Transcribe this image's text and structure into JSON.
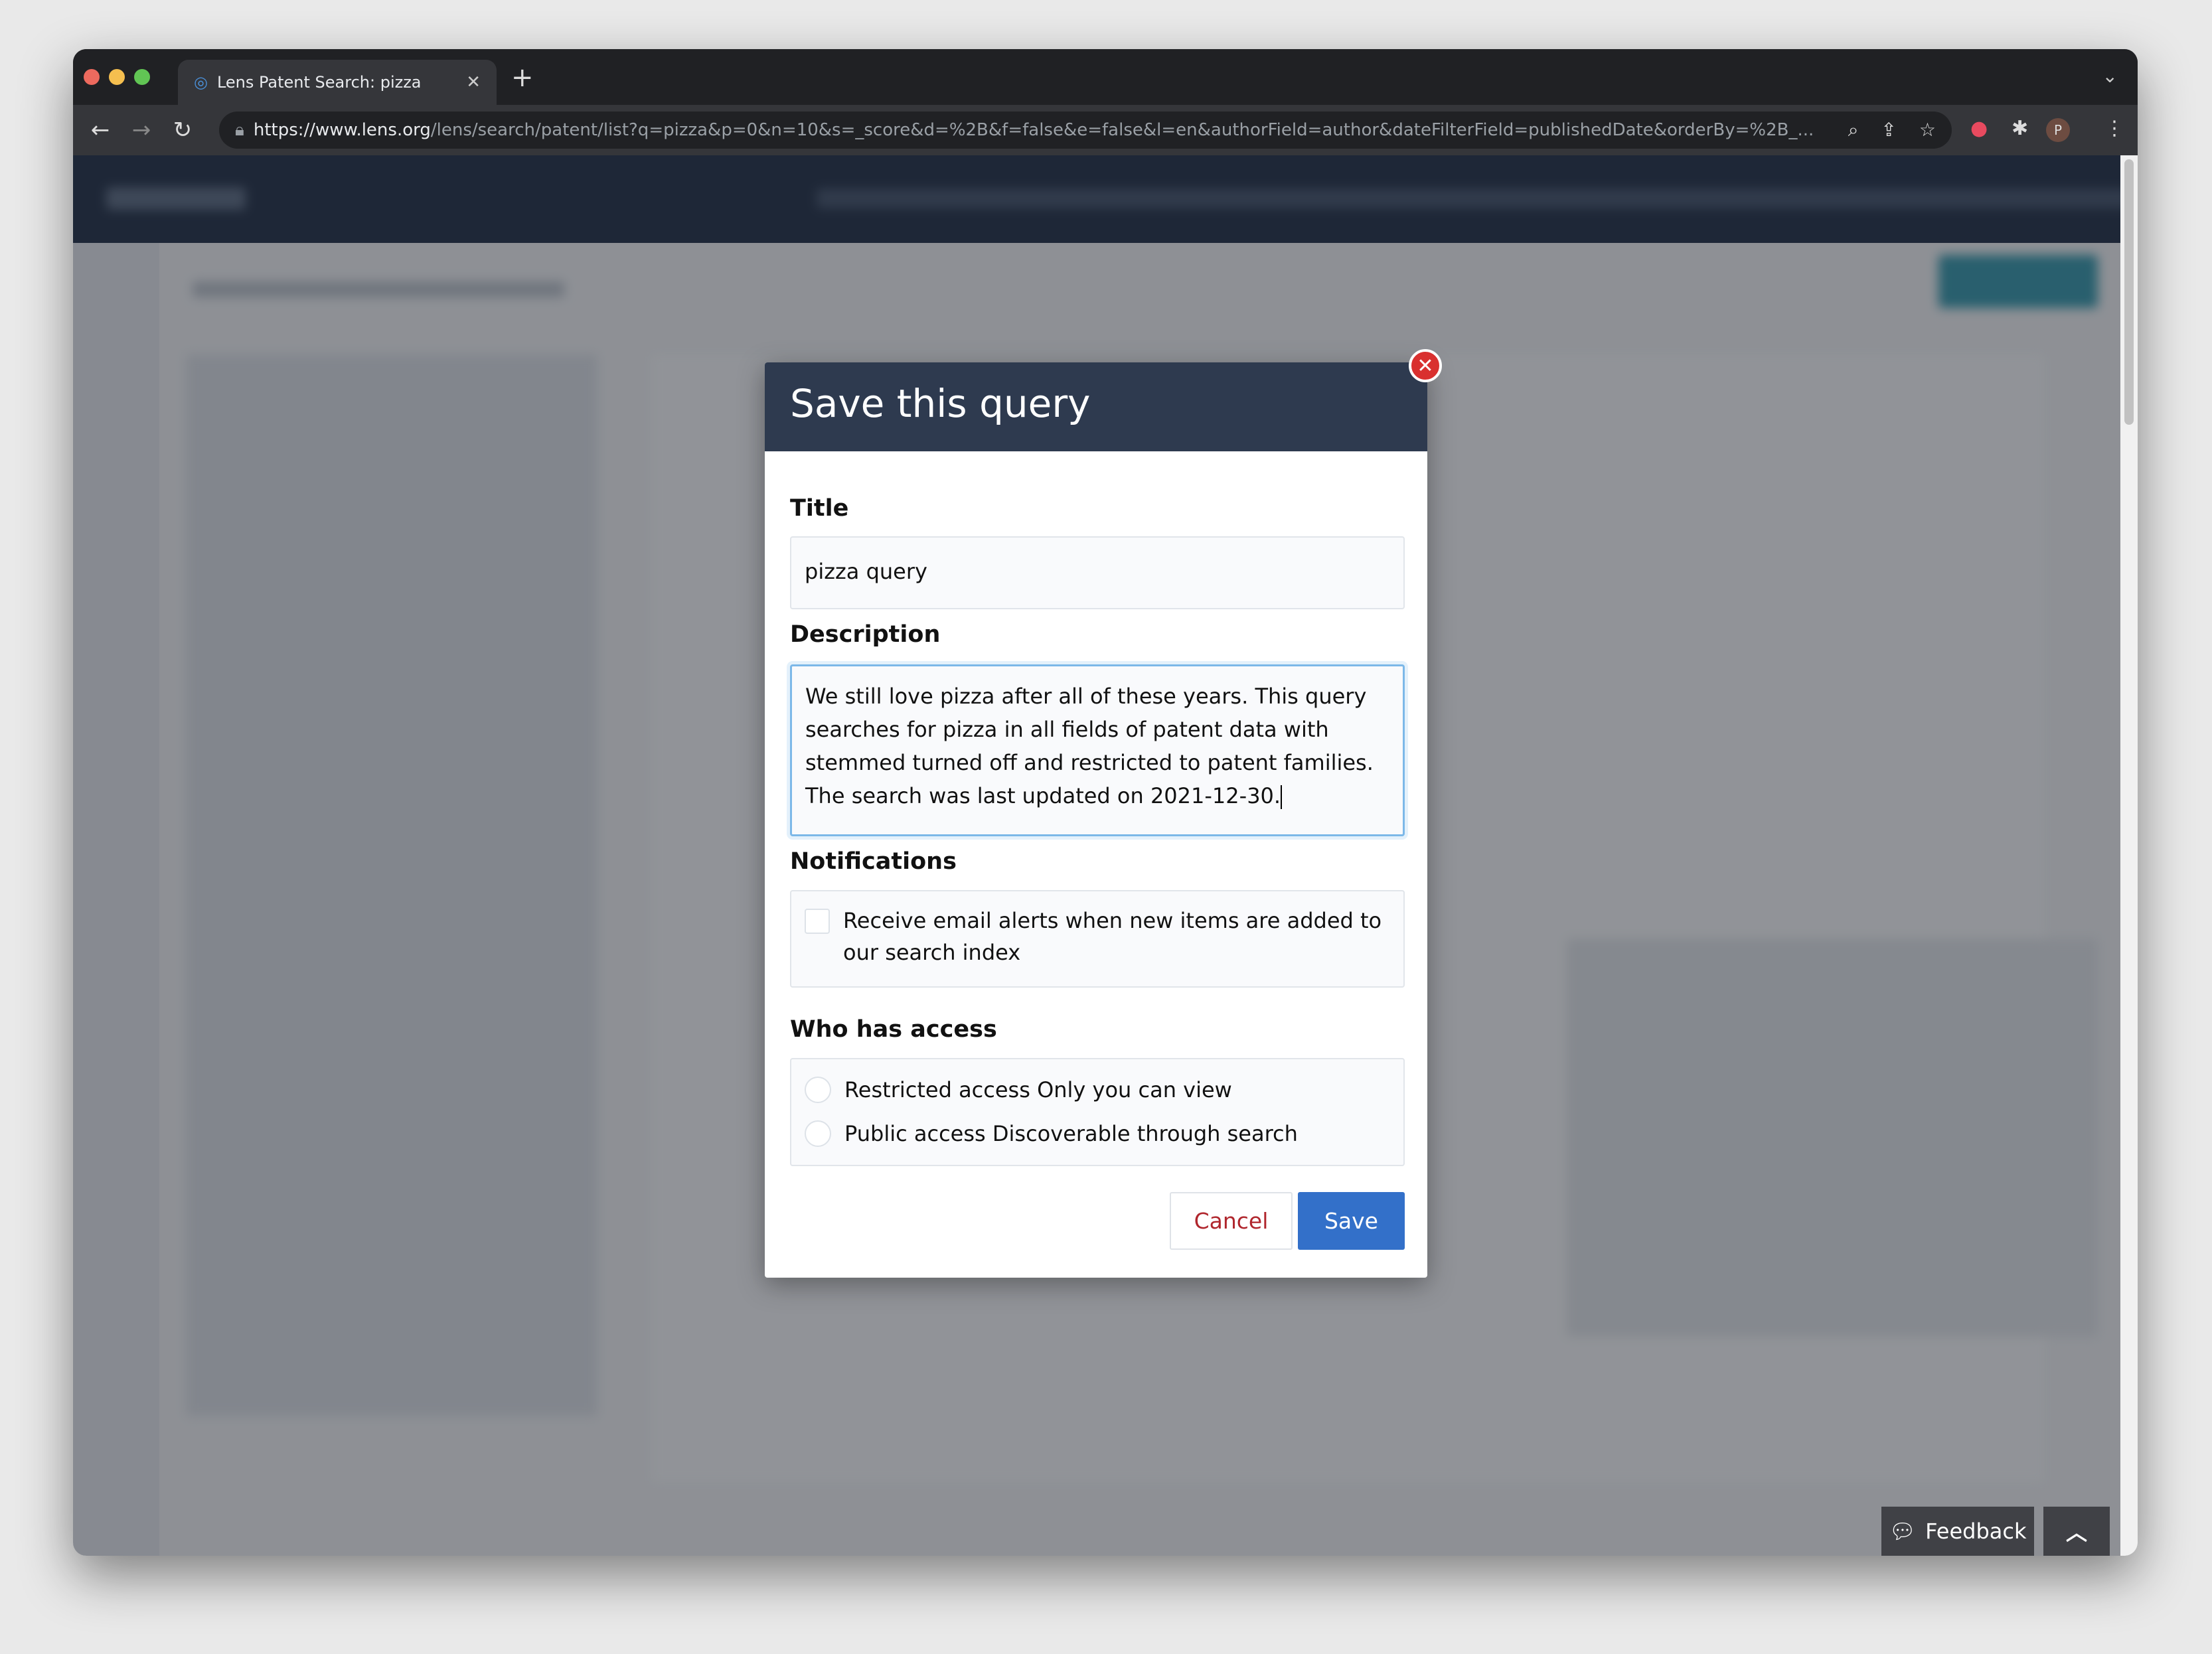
{
  "browser": {
    "tab_title": "Lens Patent Search: pizza",
    "url_host": "https://www.lens.org",
    "url_path": "/lens/search/patent/list?q=pizza&p=0&n=10&s=_score&d=%2B&f=false&e=false&l=en&authorField=author&dateFilterField=publishedDate&orderBy=%2B_...",
    "profile_initial": "P"
  },
  "modal": {
    "title": "Save this query",
    "title_label": "Title",
    "title_value": "pizza query",
    "description_label": "Description",
    "description_value": "We still love pizza after all of these years. This query searches for pizza in all fields of patent data with stemmed turned off and restricted to patent families. The search was last updated on 2021-12-30.",
    "notifications_label": "Notifications",
    "email_alert_label": "Receive email alerts when new items are added to our search index",
    "email_alert_checked": false,
    "access_label": "Who has access",
    "access_options": [
      {
        "label": "Restricted access Only you can view",
        "selected": false
      },
      {
        "label": "Public access Discoverable through search",
        "selected": false
      }
    ],
    "cancel_label": "Cancel",
    "save_label": "Save"
  },
  "footer": {
    "feedback_label": "Feedback"
  },
  "colors": {
    "modal_header": "#2e3a4f",
    "save_button": "#3370c9",
    "cancel_text": "#b0262d",
    "close_button": "#d9302f"
  }
}
